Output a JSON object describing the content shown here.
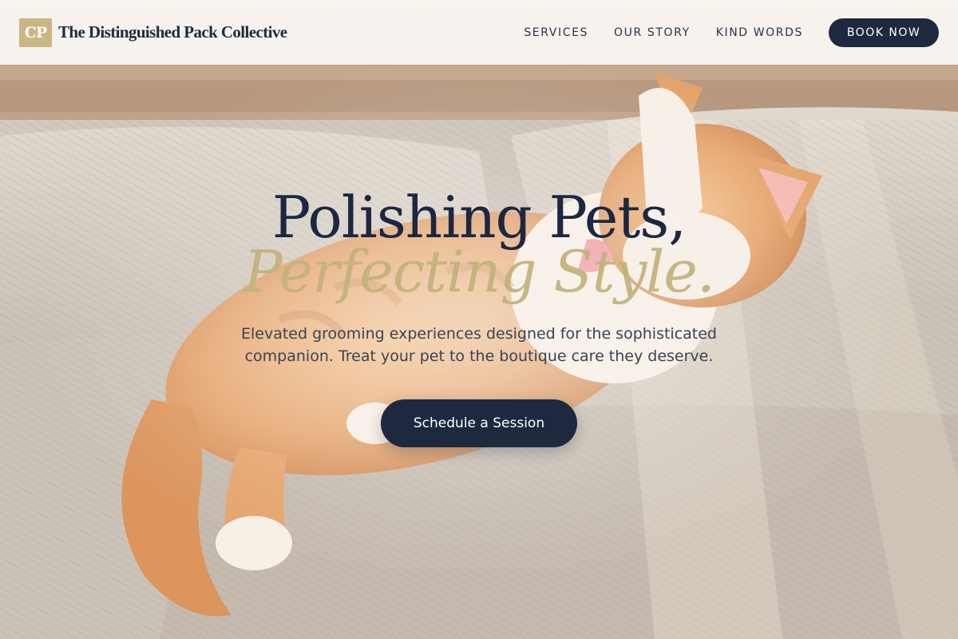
{
  "brand": {
    "monogram": "CP",
    "name": "The Distinguished Pack Collective"
  },
  "nav": {
    "links": [
      "SERVICES",
      "OUR STORY",
      "KIND WORDS"
    ],
    "book_label": "BOOK NOW"
  },
  "hero": {
    "headline_line1": "Polishing Pets,",
    "headline_line2": "Perfecting Style.",
    "subtext": "Elevated grooming experiences designed for the sophisticated companion. Treat your pet to the boutique care they deserve.",
    "cta_label": "Schedule a Session",
    "background_image": "orange-tabby-cat-on-sofa"
  },
  "colors": {
    "navy": "#1e2940",
    "gold": "#c9b682",
    "header_bg": "#faf7f4"
  }
}
